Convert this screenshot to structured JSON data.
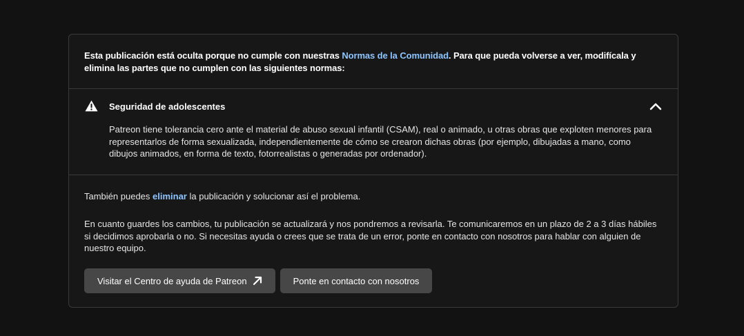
{
  "notice": {
    "text_before": "Esta publicación está oculta porque no cumple con nuestras ",
    "link": "Normas de la Comunidad",
    "text_after": ". Para que pueda volverse a ver, modifícala y elimina las partes que no cumplen con las siguientes normas:"
  },
  "guideline": {
    "icon": "warning-icon",
    "title": "Seguridad de adolescentes",
    "expanded": true,
    "body": "Patreon tiene tolerancia cero ante el material de abuso sexual infantil (CSAM), real o animado, u otras obras que exploten menores para representarlos de forma sexualizada, independientemente de cómo se crearon dichas obras (por ejemplo, dibujadas a mano, como dibujos animados, en forma de texto, fotorrealistas o generadas por ordenador)."
  },
  "delete_note": {
    "text_before": "También puedes ",
    "link": "eliminar",
    "text_after": " la publicación y solucionar así el problema."
  },
  "review_note": "En cuanto guardes los cambios, tu publicación se actualizará y nos pondremos a revisarla. Te comunicaremos en un plazo de 2 a 3 días hábiles si decidimos aprobarla o no. Si necesitas ayuda o crees que se trata de un error, ponte en contacto con nosotros para hablar con alguien de nuestro equipo.",
  "buttons": {
    "help_center": "Visitar el Centro de ayuda de Patreon",
    "contact": "Ponte en contacto con nosotros"
  },
  "colors": {
    "background": "#121212",
    "card": "#171717",
    "border": "#3a3a3a",
    "link": "#8ec5ff",
    "button": "#474747"
  }
}
